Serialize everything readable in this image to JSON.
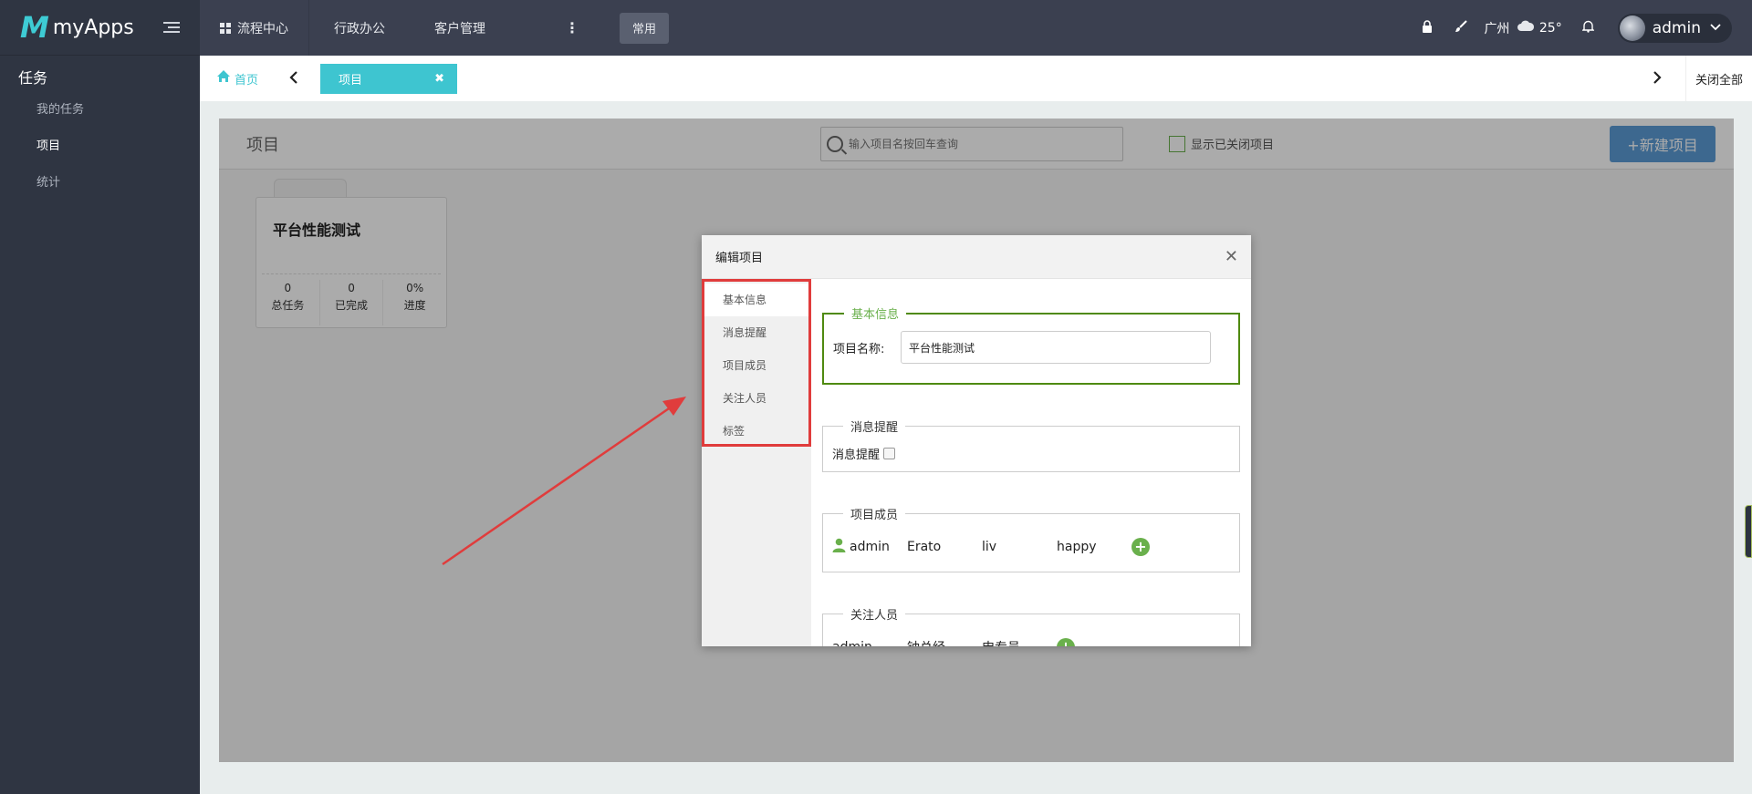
{
  "sidebar": {
    "logo_mark": "M",
    "logo_text": "myApps",
    "section_title": "任务",
    "items": [
      {
        "label": "我的任务"
      },
      {
        "label": "项目"
      },
      {
        "label": "统计"
      }
    ]
  },
  "topbar": {
    "nav": [
      {
        "label": "流程中心"
      },
      {
        "label": "行政办公"
      },
      {
        "label": "客户管理"
      }
    ],
    "more": "⋮",
    "common_btn": "常用",
    "city": "广州",
    "temperature": "25°",
    "user_name": "admin"
  },
  "tabbar": {
    "home_label": "首页",
    "active_tab": "项目",
    "close_all": "关闭全部"
  },
  "content": {
    "title": "项目",
    "search_placeholder": "输入项目名按回车查询",
    "show_closed_label": "显示已关闭项目",
    "new_button": "+新建项目",
    "card": {
      "title": "平台性能测试",
      "stats": [
        {
          "value": "0",
          "label": "总任务"
        },
        {
          "value": "0",
          "label": "已完成"
        },
        {
          "value": "0%",
          "label": "进度"
        }
      ]
    }
  },
  "modal": {
    "title": "编辑项目",
    "nav": [
      {
        "label": "基本信息"
      },
      {
        "label": "消息提醒"
      },
      {
        "label": "项目成员"
      },
      {
        "label": "关注人员"
      },
      {
        "label": "标签"
      }
    ],
    "basic": {
      "legend": "基本信息",
      "name_label": "项目名称:",
      "name_value": "平台性能测试"
    },
    "remind": {
      "legend": "消息提醒",
      "label": "消息提醒"
    },
    "members": {
      "legend": "项目成员",
      "list": [
        "admin",
        "Erato",
        "liv",
        "happy"
      ]
    },
    "watchers": {
      "legend": "关注人员",
      "list": [
        "admin",
        "钟总经",
        "申专员"
      ]
    }
  },
  "colors": {
    "accent": "#3ec5d0",
    "sidebar_bg": "#2f3542",
    "topbar_bg": "#3b4050",
    "green": "#6ab04c",
    "annotation_red": "#e03c3c"
  }
}
